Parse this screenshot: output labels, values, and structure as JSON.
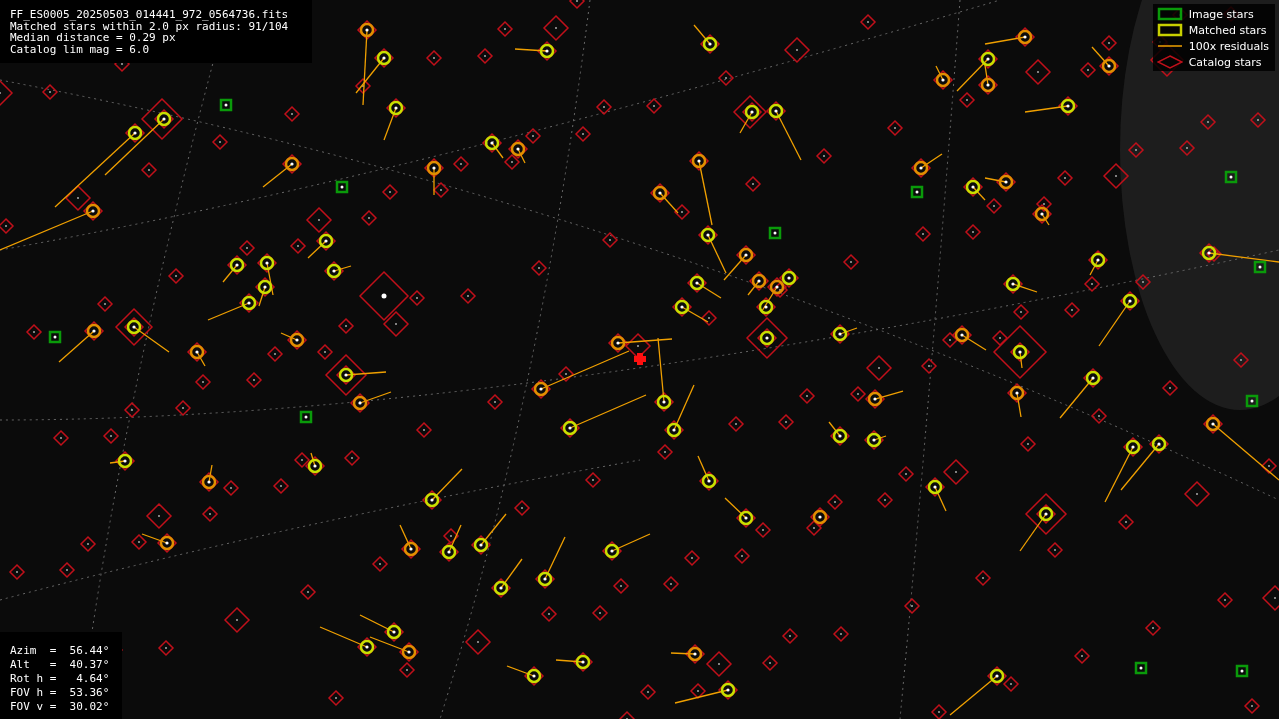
{
  "header": {
    "lines": [
      "FF_ES0005_20250503_014441_972_0564736.fits",
      "Matched stars within 2.0 px radius: 91/104",
      "Median distance = 0.29 px",
      "Catalog lim mag = 6.0"
    ]
  },
  "legend": [
    {
      "kind": "image",
      "label": "Image stars"
    },
    {
      "kind": "matched",
      "label": "Matched stars"
    },
    {
      "kind": "residual",
      "label": "100x residuals"
    },
    {
      "kind": "catalog",
      "label": "Catalog stars"
    }
  ],
  "pointing": {
    "lines": [
      "Azim  =  56.44°",
      "Alt   =  40.37°",
      "Rot h =   4.64°",
      "FOV h =  53.36°",
      "FOV v =  30.02°"
    ]
  }
}
